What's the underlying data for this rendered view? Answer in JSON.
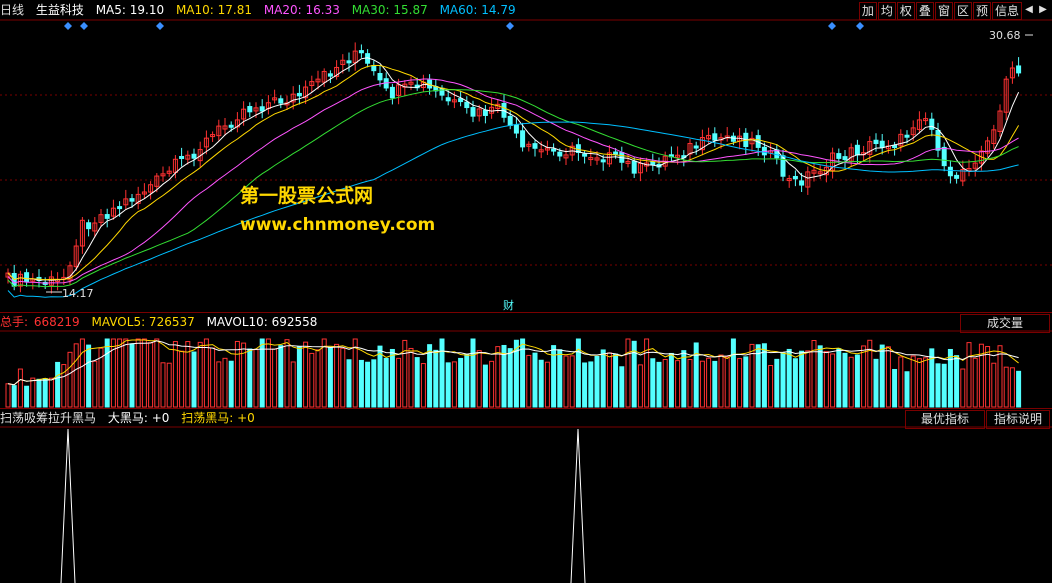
{
  "main": {
    "period": "日线",
    "stock_name": "生益科技",
    "mas": [
      {
        "label": "MA5: 19.10",
        "color": "#ffffff"
      },
      {
        "label": "MA10: 17.81",
        "color": "#ffd800"
      },
      {
        "label": "MA20: 16.33",
        "color": "#ff55ff"
      },
      {
        "label": "MA30: 15.87",
        "color": "#33dd33"
      },
      {
        "label": "MA60: 14.79",
        "color": "#00bfff"
      }
    ],
    "toolbar": [
      "加",
      "均",
      "权",
      "叠",
      "窗",
      "区",
      "预",
      "信息"
    ],
    "high_label": "30.68",
    "low_label": "14.17",
    "fin_marker": "财",
    "watermark1": "第一股票公式网",
    "watermark2": "www.chnmoney.com"
  },
  "volume": {
    "total_label": "总手:",
    "total_value": "668219",
    "mavol5": "MAVOL5: 726537",
    "mavol10": "MAVOL10: 692558",
    "selector": "成交量"
  },
  "indicator": {
    "name": "扫荡吸筹拉升黑马",
    "big_black": "大黑马: +0",
    "sweep_black": "扫荡黑马: +0",
    "btn_best": "最优指标",
    "btn_help": "指标说明"
  },
  "colors": {
    "up": "#ff3232",
    "down": "#54ffff",
    "frame": "#7a0000"
  }
}
